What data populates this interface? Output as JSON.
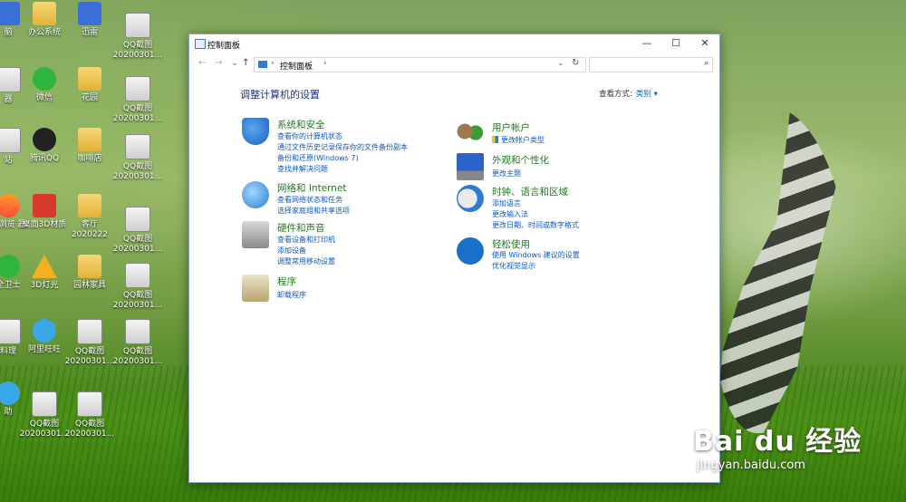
{
  "desktop": {
    "icons": [
      {
        "label": "脑",
        "style": "app-blue"
      },
      {
        "label": "办公系统",
        "style": "folder"
      },
      {
        "label": "迅雷",
        "style": "app-blue"
      },
      {
        "label": "QQ截图 20200301...",
        "style": "thumb"
      },
      {
        "label": "器",
        "style": "thumb"
      },
      {
        "label": "微信",
        "style": "app-green"
      },
      {
        "label": "花园",
        "style": "folder"
      },
      {
        "label": "QQ截图 20200301...",
        "style": "thumb"
      },
      {
        "label": "站",
        "style": "thumb"
      },
      {
        "label": "腾讯QQ",
        "style": "qq"
      },
      {
        "label": "咖啡店",
        "style": "folder"
      },
      {
        "label": "QQ截图 20200301...",
        "style": "thumb"
      },
      {
        "label": "速浏览 器",
        "style": "orange"
      },
      {
        "label": "桌面3D材质",
        "style": "app-red"
      },
      {
        "label": "客厅 2020222",
        "style": "folder"
      },
      {
        "label": "QQ截图 20200301...",
        "style": "thumb"
      },
      {
        "label": "全卫士",
        "style": "app-green"
      },
      {
        "label": "3D灯光",
        "style": "warn"
      },
      {
        "label": "园林家具",
        "style": "folder"
      },
      {
        "label": "QQ截图 20200301...",
        "style": "thumb"
      },
      {
        "label": "料理",
        "style": "thumb"
      },
      {
        "label": "阿里旺旺",
        "style": "cyan"
      },
      {
        "label": "QQ截图 20200301...",
        "style": "thumb"
      },
      {
        "label": "QQ截图 20200301...",
        "style": "thumb"
      },
      {
        "label": "助",
        "style": "cyan"
      },
      {
        "label": "QQ截图 20200301...",
        "style": "thumb"
      },
      {
        "label": "QQ截图 20200301...",
        "style": "thumb"
      }
    ]
  },
  "window": {
    "title": "控制面板",
    "controls": {
      "minimize": "—",
      "maximize": "☐",
      "close": "✕"
    },
    "nav": {
      "back": "←",
      "forward": "→",
      "dropdown": "⌄",
      "up": "↑"
    },
    "address": {
      "separator": "›",
      "crumb": "控制面板",
      "dropdown": "⌄",
      "refresh": "↻"
    },
    "search": {
      "placeholder": "",
      "icon": "⌕"
    }
  },
  "content": {
    "heading": "调整计算机的设置",
    "view_by_label": "查看方式:",
    "view_by_value": "类别 ▾",
    "left_categories": [
      {
        "title": "系统和安全",
        "links": [
          "查看你的计算机状态",
          "通过文件历史记录保存你的文件备份副本",
          "备份和还原(Windows 7)",
          "查找并解决问题"
        ]
      },
      {
        "title": "网络和 Internet",
        "links": [
          "查看网络状态和任务",
          "选择家庭组和共享选项"
        ]
      },
      {
        "title": "硬件和声音",
        "links": [
          "查看设备和打印机",
          "添加设备",
          "调整常用移动设置"
        ]
      },
      {
        "title": "程序",
        "links": [
          "卸载程序"
        ]
      }
    ],
    "right_categories": [
      {
        "title": "用户帐户",
        "links": [
          "更改帐户类型"
        ]
      },
      {
        "title": "外观和个性化",
        "links": [
          "更改主题"
        ]
      },
      {
        "title": "时钟、语言和区域",
        "links": [
          "添加语言",
          "更改输入法",
          "更改日期、时间或数字格式"
        ]
      },
      {
        "title": "轻松使用",
        "links": [
          "使用 Windows 建议的设置",
          "优化视觉显示"
        ]
      }
    ]
  },
  "watermark": {
    "brand": "Bai du 经验",
    "url": "jingyan.baidu.com"
  }
}
